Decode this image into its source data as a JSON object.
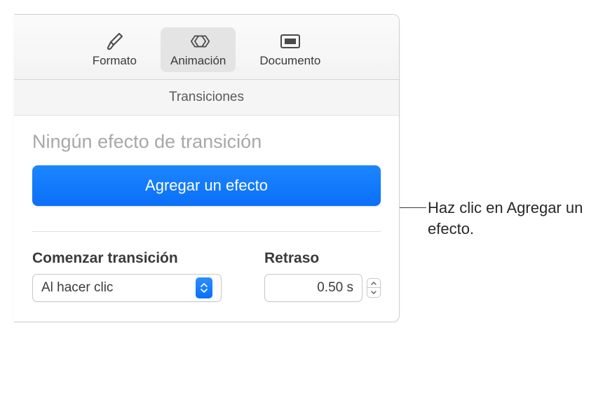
{
  "toolbar": {
    "format": {
      "label": "Formato"
    },
    "animation": {
      "label": "Animación"
    },
    "document": {
      "label": "Documento"
    }
  },
  "section": {
    "title": "Transiciones"
  },
  "content": {
    "no_effect_title": "Ningún efecto de transición",
    "add_effect_label": "Agregar un efecto"
  },
  "controls": {
    "start_label": "Comenzar transición",
    "start_value": "Al hacer clic",
    "delay_label": "Retraso",
    "delay_value": "0.50 s"
  },
  "callout": {
    "text": "Haz clic en Agregar un efecto."
  }
}
